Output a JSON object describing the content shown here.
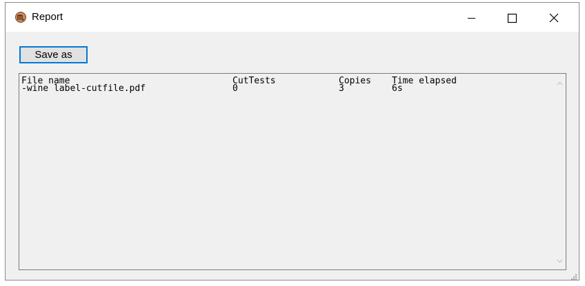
{
  "window": {
    "title": "Report",
    "icon": "app-logo-icon",
    "controls": [
      "minimize-icon",
      "maximize-icon",
      "close-icon"
    ]
  },
  "toolbar": {
    "save_label": "Save as"
  },
  "report": {
    "columns": [
      "File name",
      "CutTests",
      "Copies",
      "Time elapsed"
    ],
    "rows": [
      [
        "-wine label-cutfile.pdf",
        "0",
        "3",
        "6s"
      ]
    ]
  },
  "colors": {
    "window_bg": "#f0f0f0",
    "titlebar_bg": "#ffffff",
    "focus_border": "#0078d7"
  }
}
